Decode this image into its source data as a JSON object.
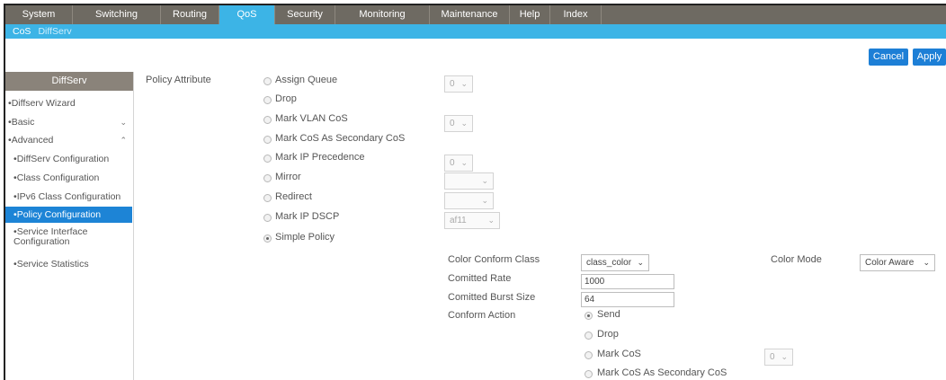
{
  "nav": {
    "tabs": [
      "System",
      "Switching",
      "Routing",
      "QoS",
      "Security",
      "Monitoring",
      "Maintenance",
      "Help",
      "Index"
    ],
    "active": "QoS"
  },
  "subnav": {
    "items": [
      "CoS",
      "DiffServ"
    ]
  },
  "actions": {
    "cancel": "Cancel",
    "apply": "Apply"
  },
  "sidebar": {
    "header": "DiffServ",
    "items": [
      {
        "label": "Diffserv Wizard"
      },
      {
        "label": "Basic"
      },
      {
        "label": "Advanced"
      },
      {
        "label": "DiffServ Configuration"
      },
      {
        "label": "Class Configuration"
      },
      {
        "label": "IPv6 Class Configuration"
      },
      {
        "label": "Policy Configuration"
      },
      {
        "label": "Service Interface Configuration"
      },
      {
        "label": "Service Statistics"
      }
    ]
  },
  "policy": {
    "label": "Policy Attribute",
    "options": [
      {
        "label": "Assign Queue",
        "value": "0"
      },
      {
        "label": "Drop"
      },
      {
        "label": "Mark VLAN CoS",
        "value": "0"
      },
      {
        "label": "Mark CoS As Secondary CoS"
      },
      {
        "label": "Mark IP Precedence",
        "value": "0"
      },
      {
        "label": "Mirror",
        "value": ""
      },
      {
        "label": "Redirect",
        "value": ""
      },
      {
        "label": "Mark IP DSCP",
        "value": "af11"
      },
      {
        "label": "Simple Policy",
        "selected": true
      }
    ]
  },
  "simple": {
    "color_conform_class_label": "Color Conform Class",
    "color_conform_class_value": "class_color",
    "color_mode_label": "Color Mode",
    "color_mode_value": "Color Aware",
    "committed_rate_label": "Comitted Rate",
    "committed_rate_value": "1000",
    "committed_burst_label": "Comitted Burst Size",
    "committed_burst_value": "64",
    "conform_action_label": "Conform Action",
    "conform_options": [
      {
        "label": "Send",
        "selected": true
      },
      {
        "label": "Drop"
      },
      {
        "label": "Mark CoS",
        "value": "0"
      },
      {
        "label": "Mark CoS As Secondary CoS"
      }
    ]
  }
}
